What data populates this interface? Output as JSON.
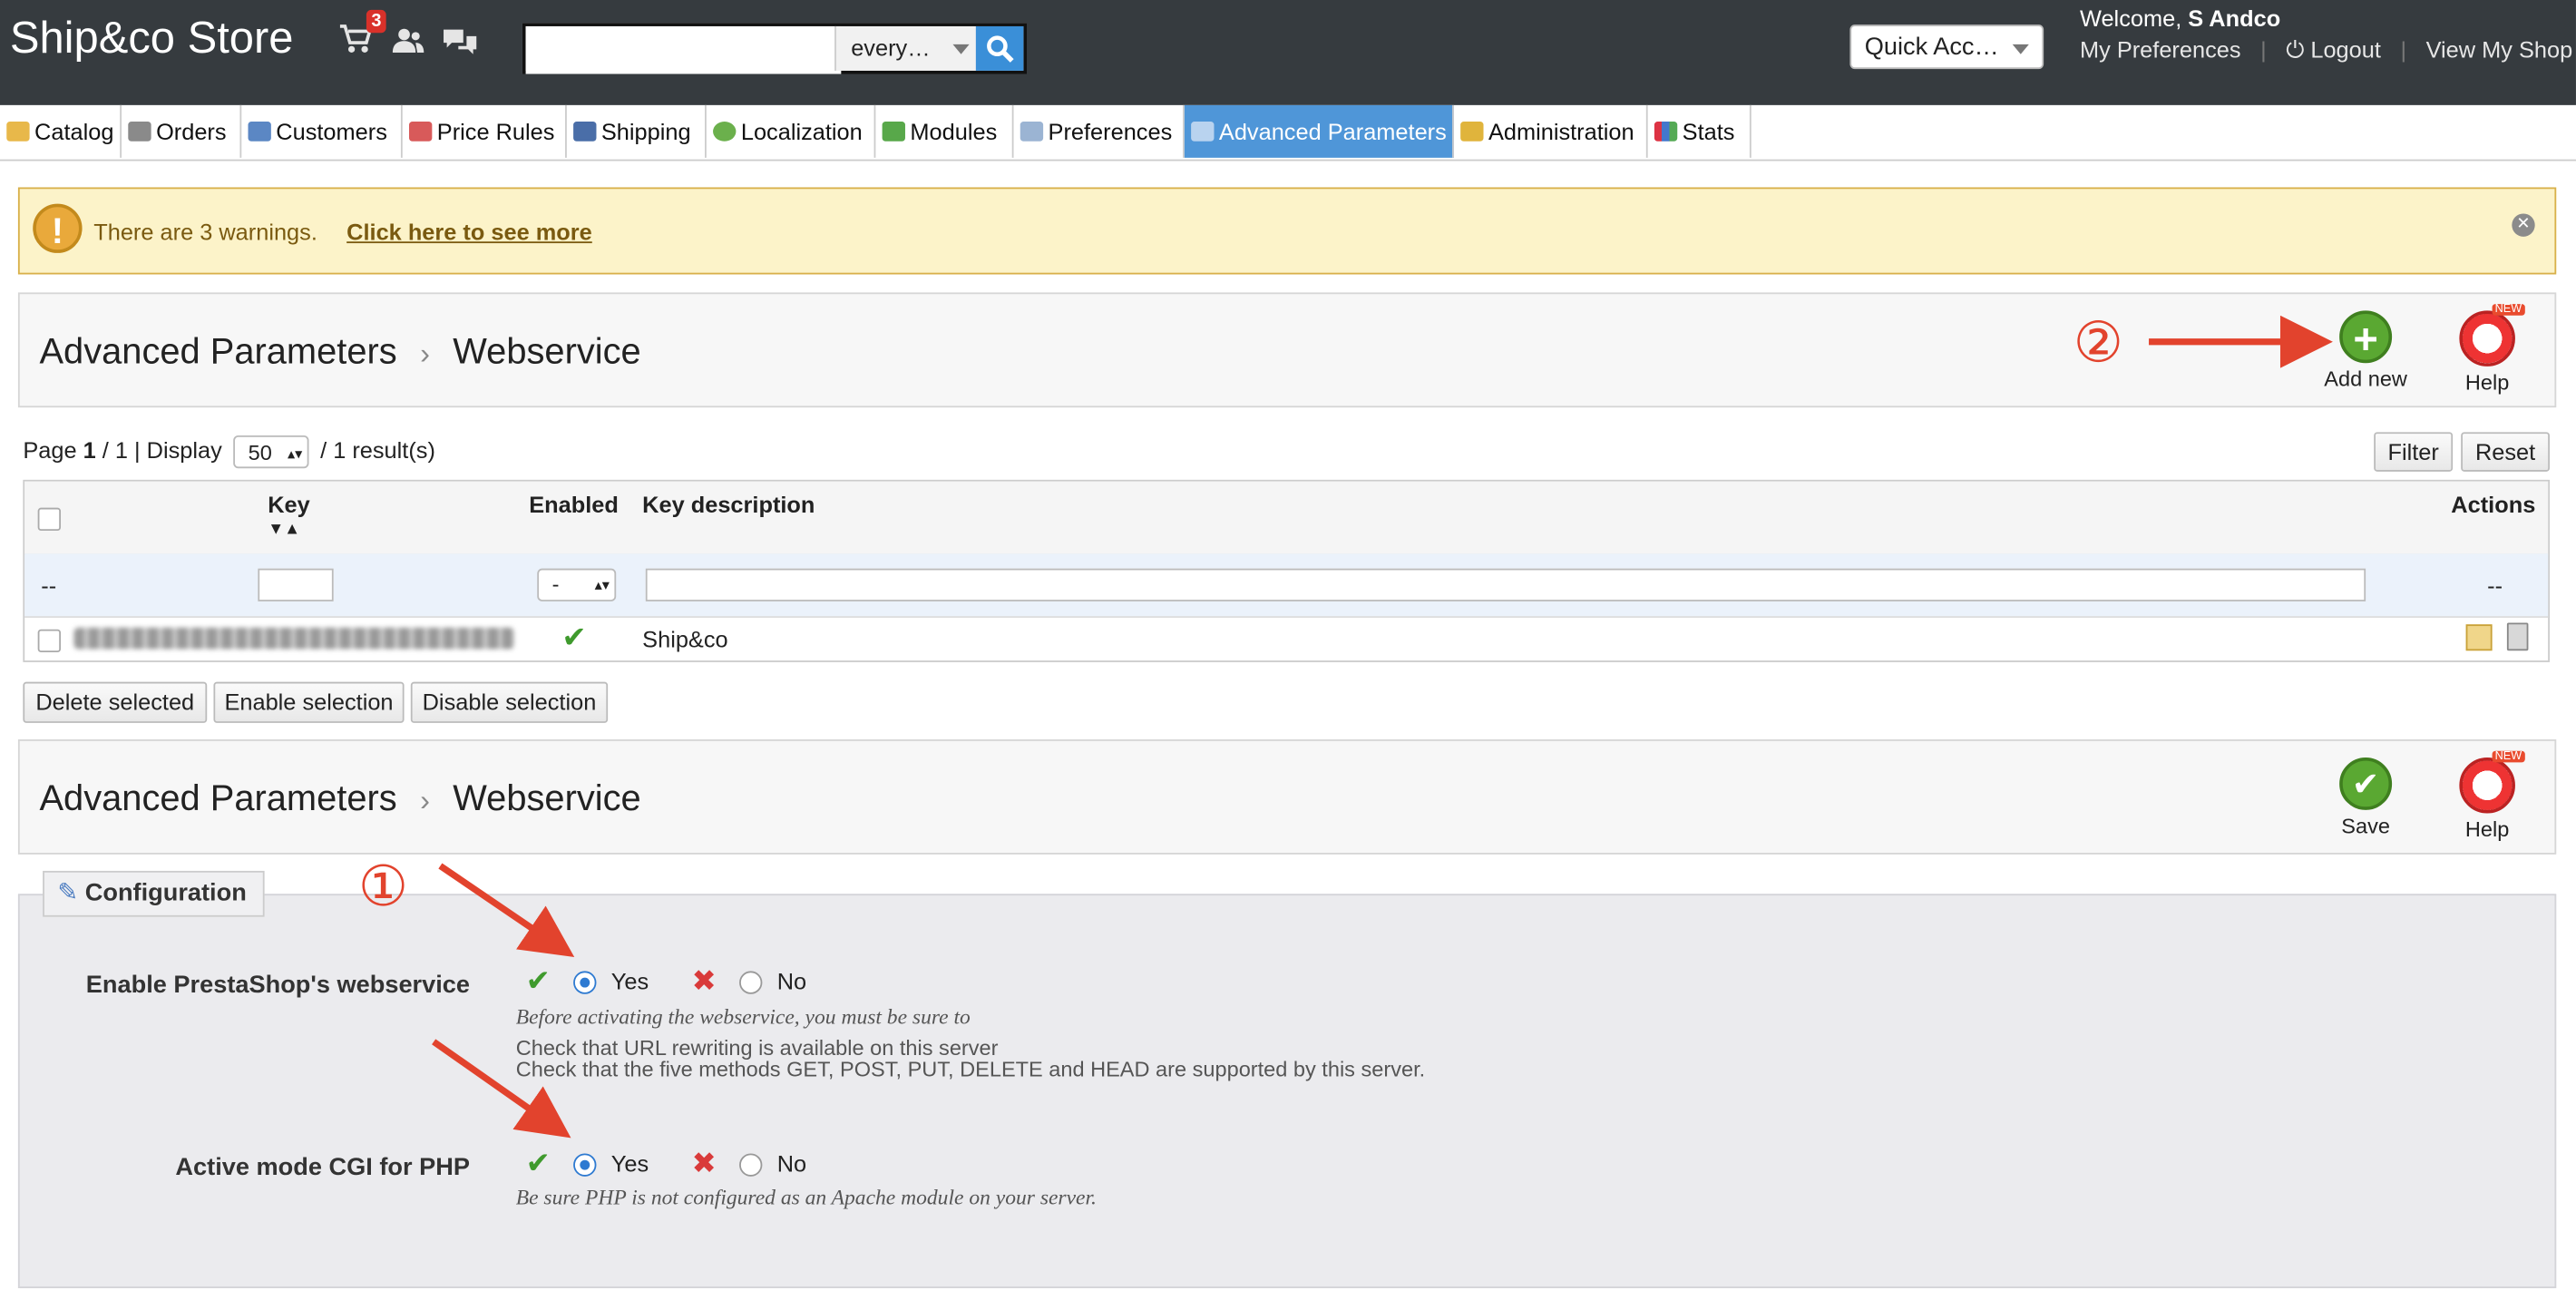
{
  "header": {
    "brand": "Ship&co Store",
    "cart_count": "3",
    "search_placeholder": "",
    "search_scope": "every…",
    "quick_access": "Quick Acc…",
    "welcome_prefix": "Welcome,",
    "welcome_user": "S Andco",
    "links": [
      "My Preferences",
      "Logout",
      "View My Shop"
    ]
  },
  "tabs": [
    "Catalog",
    "Orders",
    "Customers",
    "Price Rules",
    "Shipping",
    "Localization",
    "Modules",
    "Preferences",
    "Advanced Parameters",
    "Administration",
    "Stats"
  ],
  "warning": {
    "text": "There are 3 warnings.",
    "link": "Click here to see more"
  },
  "toolbar1": {
    "crumb_parent": "Advanced Parameters",
    "crumb_current": "Webservice",
    "add_new": "Add new",
    "help": "Help",
    "new_badge": "NEW"
  },
  "list": {
    "page_label": "Page",
    "page_current": "1",
    "page_total": "/ 1 | Display",
    "per_page": "50",
    "results": "/ 1 result(s)",
    "filter_btn": "Filter",
    "reset_btn": "Reset",
    "columns": {
      "key": "Key",
      "enabled": "Enabled",
      "description": "Key description",
      "actions": "Actions"
    },
    "filter_placeholder": "--",
    "enabled_filter": "-",
    "actions_filter": "--",
    "rows": [
      {
        "description": "Ship&co",
        "enabled": true
      }
    ],
    "bulk": [
      "Delete selected",
      "Enable selection",
      "Disable selection"
    ]
  },
  "toolbar2": {
    "crumb_parent": "Advanced Parameters",
    "crumb_current": "Webservice",
    "save": "Save",
    "help": "Help",
    "new_badge": "NEW"
  },
  "config": {
    "legend": "Configuration",
    "webservice_label": "Enable PrestaShop's webservice",
    "webservice_value": "Yes",
    "yes": "Yes",
    "no": "No",
    "webservice_hint": "Before activating the webservice, you must be sure to",
    "webservice_note1": "Check that URL rewriting is available on this server",
    "webservice_note2": "Check that the five methods GET, POST, PUT, DELETE and HEAD are supported by this server.",
    "cgi_label": "Active mode CGI for PHP",
    "cgi_value": "Yes",
    "cgi_hint": "Be sure PHP is not configured as an Apache module on your server."
  },
  "annotations": [
    "①",
    "②"
  ],
  "colors": {
    "header_bg": "#363b3f",
    "active_tab": "#4f96d8",
    "annotation": "#e2432d",
    "warning_bg": "#fcf3c9"
  }
}
